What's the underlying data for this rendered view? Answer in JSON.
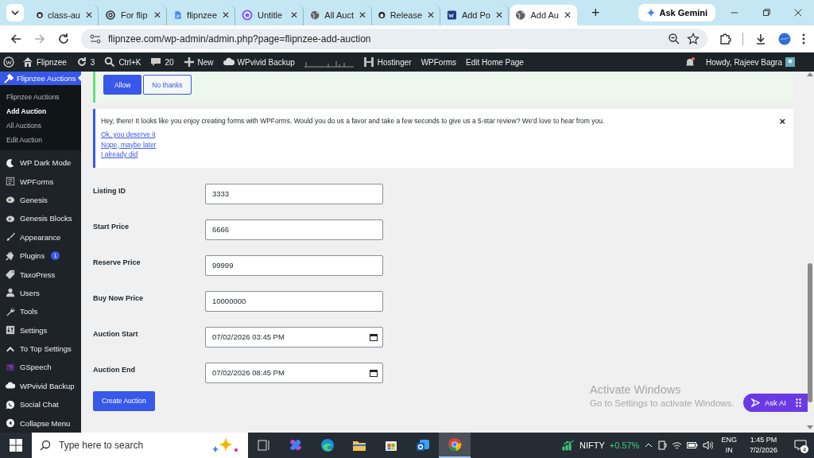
{
  "browser": {
    "tabs": [
      {
        "title": "class-au",
        "kind": "github",
        "close": "✕",
        "selected": false
      },
      {
        "title": "For flip",
        "kind": "knot",
        "close": "✕",
        "selected": false
      },
      {
        "title": "flipnzee",
        "kind": "doc",
        "close": "✕",
        "selected": false
      },
      {
        "title": "Untitle",
        "kind": "c",
        "close": "✕",
        "selected": false
      },
      {
        "title": "All Auct",
        "kind": "globe",
        "close": "✕",
        "selected": false
      },
      {
        "title": "Release",
        "kind": "github",
        "close": "✕",
        "selected": false
      },
      {
        "title": "Add Po",
        "kind": "wp",
        "close": "✕",
        "selected": false
      },
      {
        "title": "Add Au",
        "kind": "globe",
        "close": "✕",
        "selected": true
      }
    ],
    "new_tab": "+",
    "ask_gemini": "Ask Gemini",
    "url": "flipnzee.com/wp-admin/admin.php?page=flipnzee-add-auction"
  },
  "admin_bar": {
    "items": [
      {
        "kind": "home",
        "label": "Flipnzee"
      },
      {
        "kind": "updates",
        "label": "3"
      },
      {
        "kind": "search",
        "label": "Ctrl+K"
      },
      {
        "kind": "comments",
        "label": "20"
      },
      {
        "kind": "new",
        "label": "New"
      },
      {
        "kind": "cloud",
        "label": "WPvivid Backup"
      },
      {
        "kind": "graph"
      },
      {
        "kind": "hostinger",
        "label": "Hostinger"
      },
      {
        "kind": "plain",
        "label": "WPForms"
      },
      {
        "kind": "plain",
        "label": "Edit Home Page"
      }
    ],
    "greeting": "Howdy, Rajeev Bagra"
  },
  "sidebar": {
    "current": {
      "label": "Flipnzee Auctions",
      "submenu": [
        {
          "label": "Flipnzee Auctions",
          "selected": false
        },
        {
          "label": "Add Auction",
          "selected": true
        },
        {
          "label": "All Auctions",
          "selected": false
        },
        {
          "label": "Edit Auction",
          "selected": false
        }
      ]
    },
    "items": [
      {
        "label": "WP Dark Mode",
        "kind": "moon"
      },
      {
        "label": "WPForms",
        "kind": "form"
      },
      {
        "label": "Genesis",
        "kind": "blob"
      },
      {
        "label": "Genesis Blocks",
        "kind": "blob"
      },
      {
        "label": "Appearance",
        "kind": "brush"
      },
      {
        "label": "Plugins",
        "kind": "plug",
        "badge": "1"
      },
      {
        "label": "TaxoPress",
        "kind": "tag"
      },
      {
        "label": "Users",
        "kind": "user"
      },
      {
        "label": "Tools",
        "kind": "wrench"
      },
      {
        "label": "Settings",
        "kind": "sliders"
      },
      {
        "label": "To Top Settings",
        "kind": "caret"
      },
      {
        "label": "GSpeech",
        "kind": "square"
      },
      {
        "label": "WPvivid Backup",
        "kind": "cloud"
      },
      {
        "label": "Social Chat",
        "kind": "chat"
      },
      {
        "label": "Collapse Menu",
        "kind": "collapse"
      }
    ]
  },
  "notices": {
    "permission": {
      "buttons": [
        "Allow",
        "No thanks"
      ]
    },
    "review": {
      "text": "Hey, there! It looks like you enjoy creating forms with WPForms. Would you do us a favor and take a few seconds to give us a 5-star review? We'd love to hear from you.",
      "links": [
        "Ok, you deserve it",
        "Nope, maybe later",
        "I already did"
      ],
      "dismiss": "×"
    }
  },
  "form": {
    "fields": [
      {
        "label": "Listing ID",
        "value": "3333",
        "kind": "text"
      },
      {
        "label": "Start Price",
        "value": "6666",
        "kind": "text"
      },
      {
        "label": "Reserve Price",
        "value": "99999",
        "kind": "text"
      },
      {
        "label": "Buy Now Price",
        "value": "10000000",
        "kind": "text"
      },
      {
        "label": "Auction Start",
        "value": "07/02/2026 03:45 PM",
        "kind": "datetime"
      },
      {
        "label": "Auction End",
        "value": "07/02/2026 08:45 PM",
        "kind": "datetime"
      }
    ],
    "submit": "Create Auction"
  },
  "ask_ai": "Ask AI",
  "activation": {
    "title": "Activate Windows",
    "subtitle": "Go to Settings to activate Windows."
  },
  "taskbar": {
    "search_placeholder": "Type here to search",
    "apps": [
      {
        "kind": "taskview",
        "selected": false
      },
      {
        "kind": "copilot",
        "selected": false
      },
      {
        "kind": "edge",
        "selected": false
      },
      {
        "kind": "folder",
        "selected": false
      },
      {
        "kind": "store",
        "selected": false
      },
      {
        "kind": "mail",
        "selected": false
      },
      {
        "kind": "chrome",
        "selected": true
      }
    ],
    "stock": {
      "name": "NIFTY",
      "change": "+0.57%"
    },
    "language": "ENG",
    "region": "IN",
    "time": "1:45 PM",
    "date": "7/2/2026",
    "notifications": "4"
  }
}
